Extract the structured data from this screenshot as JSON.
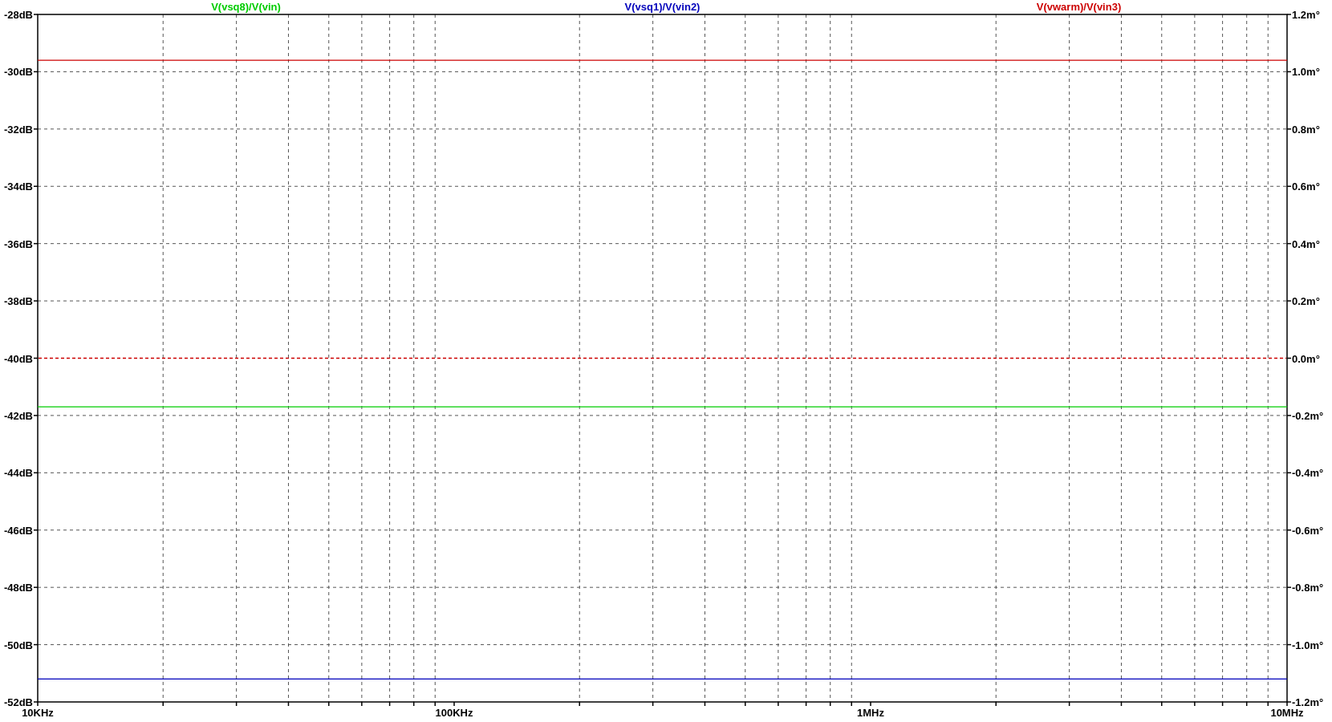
{
  "plot": {
    "chart_data": {
      "type": "line",
      "categories": [
        "10KHz",
        "100KHz",
        "1MHz",
        "10MHz"
      ],
      "series": [
        {
          "name": "V(vsq8)/V(vin)",
          "color": "#00cc00",
          "values": [
            -41.7,
            -41.7,
            -41.7,
            -41.7
          ]
        },
        {
          "name": "V(vsq1)/V(vin2)",
          "color": "#0000bb",
          "values": [
            -51.2,
            -51.2,
            -51.2,
            -51.2
          ]
        },
        {
          "name": "V(vwarm)/V(vin3)",
          "color": "#cc0000",
          "values": [
            -29.6,
            -29.6,
            -29.6,
            -29.6
          ]
        }
      ],
      "grid": true,
      "ref_lines": [
        {
          "axis": "y",
          "value": -40,
          "color": "#cc0000"
        }
      ],
      "ylim": [
        -52,
        -28
      ],
      "yticks": [
        {
          "value": -28,
          "label": "-28dB"
        },
        {
          "value": -30,
          "label": "-30dB"
        },
        {
          "value": -32,
          "label": "-32dB"
        },
        {
          "value": -34,
          "label": "-34dB"
        },
        {
          "value": -36,
          "label": "-36dB"
        },
        {
          "value": -38,
          "label": "-38dB"
        },
        {
          "value": -40,
          "label": "-40dB"
        },
        {
          "value": -42,
          "label": "-42dB"
        },
        {
          "value": -44,
          "label": "-44dB"
        },
        {
          "value": -46,
          "label": "-46dB"
        },
        {
          "value": -48,
          "label": "-48dB"
        },
        {
          "value": -50,
          "label": "-50dB"
        },
        {
          "value": -52,
          "label": "-52dB"
        }
      ],
      "y2lim": [
        -1.2,
        1.2
      ],
      "y2ticks": [
        {
          "value": 1.2,
          "label": "1.2m°"
        },
        {
          "value": 1.0,
          "label": "1.0m°"
        },
        {
          "value": 0.8,
          "label": "0.8m°"
        },
        {
          "value": 0.6,
          "label": "0.6m°"
        },
        {
          "value": 0.4,
          "label": "0.4m°"
        },
        {
          "value": 0.2,
          "label": "0.2m°"
        },
        {
          "value": 0.0,
          "label": "0.0m°"
        },
        {
          "value": -0.2,
          "label": "-0.2m°"
        },
        {
          "value": -0.4,
          "label": "-0.4m°"
        },
        {
          "value": -0.6,
          "label": "-0.6m°"
        },
        {
          "value": -0.8,
          "label": "-0.8m°"
        },
        {
          "value": -1.0,
          "label": "-1.0m°"
        },
        {
          "value": -1.2,
          "label": "-1.2m°"
        }
      ]
    }
  }
}
